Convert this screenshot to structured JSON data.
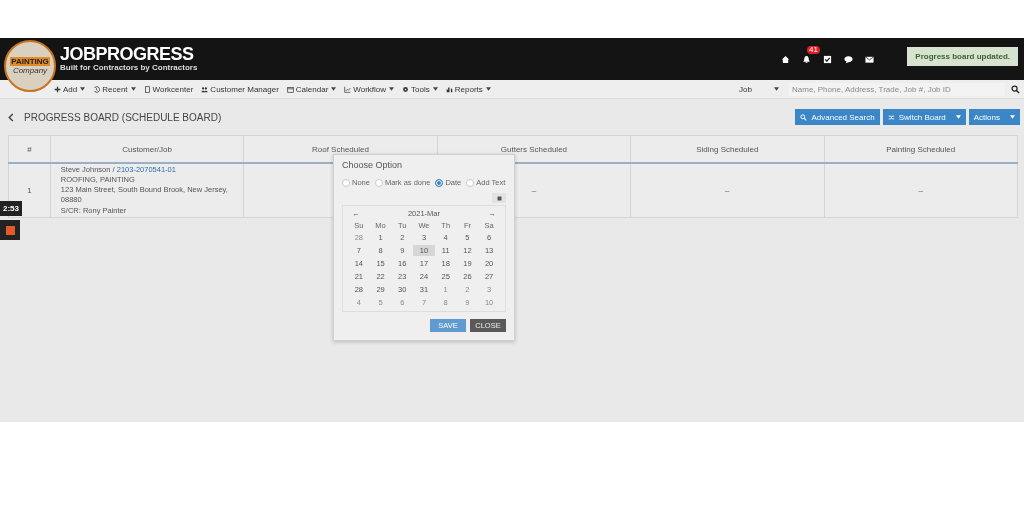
{
  "header": {
    "logo_top": "PAINTING",
    "logo_bottom": "Company",
    "brand": "JOBPROGRESS",
    "tagline": "Built for Contractors by Contractors",
    "notification_count": "41",
    "toast": "Progress board updated."
  },
  "nav": [
    {
      "label": "Add",
      "kind": "plus",
      "dropdown": true
    },
    {
      "label": "Recent",
      "kind": "history",
      "dropdown": true
    },
    {
      "label": "Workcenter",
      "kind": "page",
      "dropdown": false
    },
    {
      "label": "Customer Manager",
      "kind": "users",
      "dropdown": false
    },
    {
      "label": "Calendar",
      "kind": "calendar",
      "dropdown": true
    },
    {
      "label": "Workflow",
      "kind": "chart",
      "dropdown": true
    },
    {
      "label": "Tools",
      "kind": "gear",
      "dropdown": true
    },
    {
      "label": "Reports",
      "kind": "bars",
      "dropdown": true
    }
  ],
  "search": {
    "scope": "Job",
    "placeholder": "Name, Phone, Address, Trade, Job #, Job ID"
  },
  "page_title": "PROGRESS BOARD (SCHEDULE BOARD)",
  "actions": [
    {
      "label": "Advanced Search",
      "kind": "search",
      "split": false
    },
    {
      "label": "Switch Board",
      "kind": "shuffle",
      "split": true
    },
    {
      "label": "Actions",
      "kind": "none",
      "split": true
    }
  ],
  "table": {
    "columns": [
      "#",
      "Customer/Job",
      "Roof Scheduled",
      "Gutters Scheduled",
      "Siding Scheduled",
      "Painting Scheduled"
    ],
    "rows": [
      {
        "cells": [
          "1",
          {
            "customer": "Steve Johnson /",
            "job_link": "2103-2070541-01",
            "trades": "ROOFING, PAINTING",
            "address": "123 Main Street, South Bound Brook, New Jersey, 08880",
            "salesperson": "S/CR: Rony Painter"
          },
          null,
          "–",
          "–",
          "–"
        ]
      }
    ]
  },
  "dialog": {
    "title": "Choose Option",
    "options": [
      {
        "label": "None",
        "selected": false
      },
      {
        "label": "Mark as done",
        "selected": false
      },
      {
        "label": "Date",
        "selected": true
      },
      {
        "label": "Add Text",
        "selected": false
      }
    ],
    "month": "2021-Mar",
    "prev": "←",
    "next": "→",
    "weekdays": [
      "Su",
      "Mo",
      "Tu",
      "We",
      "Th",
      "Fr",
      "Sa"
    ],
    "days": [
      {
        "d": "28",
        "muted": true,
        "selected": false
      },
      {
        "d": "1",
        "muted": false,
        "selected": false
      },
      {
        "d": "2",
        "muted": false,
        "selected": false
      },
      {
        "d": "3",
        "muted": false,
        "selected": false
      },
      {
        "d": "4",
        "muted": false,
        "selected": false
      },
      {
        "d": "5",
        "muted": false,
        "selected": false
      },
      {
        "d": "6",
        "muted": false,
        "selected": false
      },
      {
        "d": "7",
        "muted": false,
        "selected": false
      },
      {
        "d": "8",
        "muted": false,
        "selected": false
      },
      {
        "d": "9",
        "muted": false,
        "selected": false
      },
      {
        "d": "10",
        "muted": false,
        "selected": true
      },
      {
        "d": "11",
        "muted": false,
        "selected": false
      },
      {
        "d": "12",
        "muted": false,
        "selected": false
      },
      {
        "d": "13",
        "muted": false,
        "selected": false
      },
      {
        "d": "14",
        "muted": false,
        "selected": false
      },
      {
        "d": "15",
        "muted": false,
        "selected": false
      },
      {
        "d": "16",
        "muted": false,
        "selected": false
      },
      {
        "d": "17",
        "muted": false,
        "selected": false
      },
      {
        "d": "18",
        "muted": false,
        "selected": false
      },
      {
        "d": "19",
        "muted": false,
        "selected": false
      },
      {
        "d": "20",
        "muted": false,
        "selected": false
      },
      {
        "d": "21",
        "muted": false,
        "selected": false
      },
      {
        "d": "22",
        "muted": false,
        "selected": false
      },
      {
        "d": "23",
        "muted": false,
        "selected": false
      },
      {
        "d": "24",
        "muted": false,
        "selected": false
      },
      {
        "d": "25",
        "muted": false,
        "selected": false
      },
      {
        "d": "26",
        "muted": false,
        "selected": false
      },
      {
        "d": "27",
        "muted": false,
        "selected": false
      },
      {
        "d": "28",
        "muted": false,
        "selected": false
      },
      {
        "d": "29",
        "muted": false,
        "selected": false
      },
      {
        "d": "30",
        "muted": false,
        "selected": false
      },
      {
        "d": "31",
        "muted": false,
        "selected": false
      },
      {
        "d": "1",
        "muted": true,
        "selected": false
      },
      {
        "d": "2",
        "muted": true,
        "selected": false
      },
      {
        "d": "3",
        "muted": true,
        "selected": false
      },
      {
        "d": "4",
        "muted": true,
        "selected": false
      },
      {
        "d": "5",
        "muted": true,
        "selected": false
      },
      {
        "d": "6",
        "muted": true,
        "selected": false
      },
      {
        "d": "7",
        "muted": true,
        "selected": false
      },
      {
        "d": "8",
        "muted": true,
        "selected": false
      },
      {
        "d": "9",
        "muted": true,
        "selected": false
      },
      {
        "d": "10",
        "muted": true,
        "selected": false
      }
    ],
    "save": "SAVE",
    "close": "CLOSE"
  },
  "recorder": {
    "time": "2:53"
  }
}
